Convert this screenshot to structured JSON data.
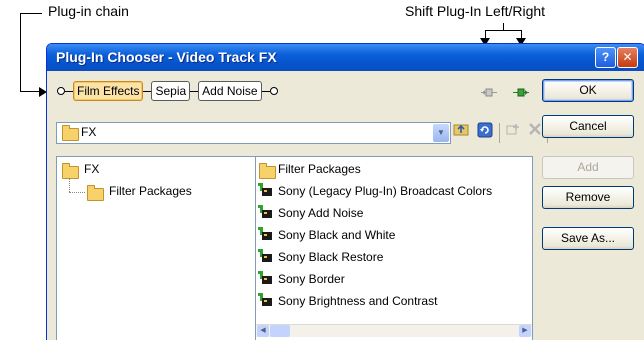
{
  "annotations": {
    "plugin_chain": "Plug-in chain",
    "shift_plugin": "Shift Plug-In Left/Right"
  },
  "window": {
    "title": "Plug-In Chooser - Video Track FX",
    "help_glyph": "?",
    "close_glyph": "✕"
  },
  "chain": {
    "items": [
      "Film Effects",
      "Sepia",
      "Add Noise"
    ],
    "active_index": 0
  },
  "location": {
    "value": "FX"
  },
  "tree": {
    "root": "FX",
    "child": "Filter Packages"
  },
  "list": {
    "folder_item": "Filter Packages",
    "items": [
      "Sony (Legacy Plug-In) Broadcast Colors",
      "Sony Add Noise",
      "Sony Black and White",
      "Sony Black Restore",
      "Sony Border",
      "Sony Brightness and Contrast"
    ]
  },
  "buttons": {
    "ok": "OK",
    "cancel": "Cancel",
    "add": "Add",
    "remove": "Remove",
    "save_as": "Save As..."
  },
  "icons": {
    "combo_dropdown": "chevron-down-icon",
    "up_folder": "up-folder-icon",
    "refresh": "refresh-icon",
    "add_to_chain": "add-plugin-icon",
    "delete": "delete-icon",
    "views": "views-icon",
    "shift_left": "shift-left-icon",
    "shift_right": "shift-right-icon"
  },
  "colors": {
    "titlebar": "#0553cc",
    "active_chip": "#fbe3a8"
  }
}
